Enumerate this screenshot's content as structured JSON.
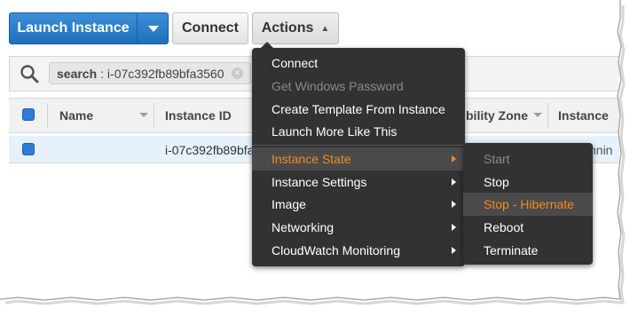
{
  "toolbar": {
    "launch_label": "Launch Instance",
    "connect_label": "Connect",
    "actions_label": "Actions"
  },
  "search": {
    "token_key": "search",
    "token_value": ": i-07c392fb89bfa3560",
    "clear_glyph": "⊗"
  },
  "table": {
    "columns": [
      "Name",
      "Instance ID",
      "bility Zone",
      "Instance"
    ],
    "rows": [
      {
        "name": "",
        "instance_id": "i-07c392fb89bfa",
        "state_fragment": "nnin"
      }
    ]
  },
  "actions_menu": {
    "items": [
      {
        "label": "Connect",
        "enabled": true
      },
      {
        "label": "Get Windows Password",
        "enabled": false
      },
      {
        "label": "Create Template From Instance",
        "enabled": true
      },
      {
        "label": "Launch More Like This",
        "enabled": true
      },
      {
        "label": "Instance State",
        "enabled": true,
        "submenu": true,
        "highlighted": true
      },
      {
        "label": "Instance Settings",
        "enabled": true,
        "submenu": true
      },
      {
        "label": "Image",
        "enabled": true,
        "submenu": true
      },
      {
        "label": "Networking",
        "enabled": true,
        "submenu": true
      },
      {
        "label": "CloudWatch Monitoring",
        "enabled": true,
        "submenu": true
      }
    ]
  },
  "instance_state_menu": {
    "items": [
      {
        "label": "Start",
        "enabled": false
      },
      {
        "label": "Stop",
        "enabled": true
      },
      {
        "label": "Stop - Hibernate",
        "enabled": true,
        "highlighted": true
      },
      {
        "label": "Reboot",
        "enabled": true
      },
      {
        "label": "Terminate",
        "enabled": true
      }
    ]
  },
  "colors": {
    "primary_button": "#1f6fbd",
    "menu_background": "#323232",
    "highlight_text": "#f58a1f",
    "selected_row": "#e6f1fb",
    "disabled_text": "#8a8a8a"
  },
  "icons": {
    "search": "search-icon",
    "launch_dropdown": "caret-down-icon",
    "actions_toggle": "chevron-up-icon",
    "submenu": "chevron-right-icon",
    "sort": "sort-caret-icon",
    "clear_token": "clear-token-icon"
  }
}
